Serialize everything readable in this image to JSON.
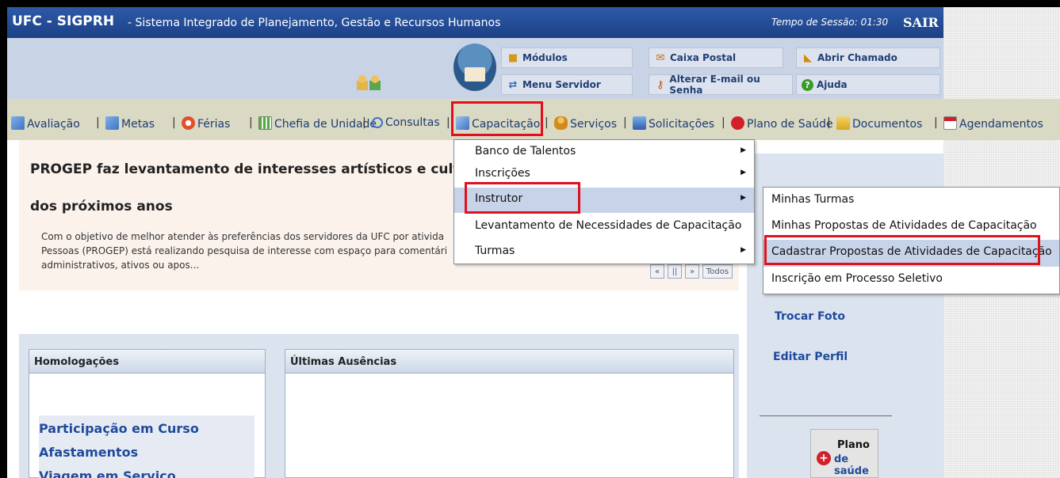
{
  "titlebar": {
    "system_name": "UFC - SIGPRH",
    "subtitle": "- Sistema Integrado de Planejamento, Gestão e Recursos Humanos",
    "session_label": "Tempo de Sessão: 01:30",
    "logout_label": "SAIR"
  },
  "header_buttons": {
    "modulos": "Módulos",
    "caixa_postal": "Caixa Postal",
    "abrir_chamado": "Abrir Chamado",
    "menu_servidor": "Menu Servidor",
    "alterar_email": "Alterar E-mail ou Senha",
    "ajuda": "Ajuda"
  },
  "menu": {
    "items": [
      {
        "label": "Avaliação",
        "icon": "pencil-icon"
      },
      {
        "label": "Metas",
        "icon": "pencil-icon"
      },
      {
        "label": "Férias",
        "icon": "lifebuoy-icon"
      },
      {
        "label": "Chefia de Unidade",
        "icon": "grid-icon"
      },
      {
        "label": "Consultas",
        "icon": "magnifier-icon"
      },
      {
        "label": "Capacitação",
        "icon": "notepad-icon"
      },
      {
        "label": "Serviços",
        "icon": "person-icon"
      },
      {
        "label": "Solicitações",
        "icon": "document-icon"
      },
      {
        "label": "Plano de Saúde",
        "icon": "medical-cross-icon"
      },
      {
        "label": "Documentos",
        "icon": "folder-icon"
      },
      {
        "label": "Agendamentos",
        "icon": "calendar-icon"
      }
    ],
    "separator": "|"
  },
  "dropdown": {
    "items": [
      "Banco de Talentos",
      "Inscrições",
      "Instrutor",
      "Levantamento de Necessidades de Capacitação",
      "Turmas"
    ],
    "highlighted": "Instrutor"
  },
  "submenu": {
    "items": [
      "Minhas Turmas",
      "Minhas Propostas de Atividades de Capacitação",
      "Cadastrar Propostas de Atividades de Capacitação",
      "Inscrição em Processo Seletivo"
    ],
    "highlighted": "Cadastrar Propostas de Atividades de Capacitação"
  },
  "news": {
    "title_line1": "PROGEP faz levantamento de interesses artísticos e cultura",
    "title_line2": "dos próximos anos",
    "text_line1": "Com o objetivo de melhor atender às preferências dos servidores da UFC por ativida",
    "text_line2": "Pessoas (PROGEP) está realizando pesquisa de interesse com espaço para comentári",
    "text_line3": "administrativos, ativos ou apos...",
    "pager": {
      "first": "«",
      "pause": "||",
      "last": "»",
      "all": "Todos"
    }
  },
  "right_panel": {
    "trocar_foto": "Trocar Foto",
    "editar_perfil": "Editar Perfil",
    "plano_title": "Plano",
    "plano_sub": "de saúde"
  },
  "homologacoes": {
    "header": "Homologações",
    "links": [
      "Participação em Curso",
      "Afastamentos",
      "Viagem em Serviço"
    ]
  },
  "ausencias": {
    "header": "Últimas Ausências"
  },
  "colors": {
    "titlebar": "#1c4186",
    "menubar": "#d9d9c4",
    "highlight_box": "#e0101e",
    "link": "#1f4a9c"
  }
}
